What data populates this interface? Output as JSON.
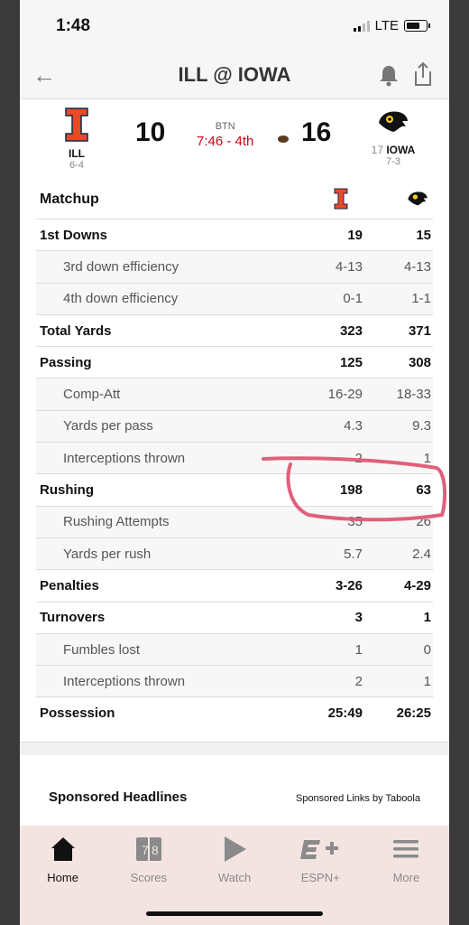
{
  "status_bar": {
    "time": "1:48",
    "network": "LTE"
  },
  "header": {
    "title": "ILL @ IOWA"
  },
  "scoreboard": {
    "away": {
      "abbr": "ILL",
      "record": "6-4",
      "score": "10"
    },
    "home": {
      "rank": "17",
      "abbr": "IOWA",
      "record": "7-3",
      "score": "16"
    },
    "network": "BTN",
    "clock": "7:46 - 4th"
  },
  "matchup_label": "Matchup",
  "stats": [
    {
      "label": "1st Downs",
      "ill": "19",
      "iowa": "15",
      "type": "main"
    },
    {
      "label": "3rd down efficiency",
      "ill": "4-13",
      "iowa": "4-13",
      "type": "sub"
    },
    {
      "label": "4th down efficiency",
      "ill": "0-1",
      "iowa": "1-1",
      "type": "sub"
    },
    {
      "label": "Total Yards",
      "ill": "323",
      "iowa": "371",
      "type": "main"
    },
    {
      "label": "Passing",
      "ill": "125",
      "iowa": "308",
      "type": "main"
    },
    {
      "label": "Comp-Att",
      "ill": "16-29",
      "iowa": "18-33",
      "type": "sub"
    },
    {
      "label": "Yards per pass",
      "ill": "4.3",
      "iowa": "9.3",
      "type": "sub"
    },
    {
      "label": "Interceptions thrown",
      "ill": "2",
      "iowa": "1",
      "type": "sub"
    },
    {
      "label": "Rushing",
      "ill": "198",
      "iowa": "63",
      "type": "main"
    },
    {
      "label": "Rushing Attempts",
      "ill": "35",
      "iowa": "26",
      "type": "sub"
    },
    {
      "label": "Yards per rush",
      "ill": "5.7",
      "iowa": "2.4",
      "type": "sub"
    },
    {
      "label": "Penalties",
      "ill": "3-26",
      "iowa": "4-29",
      "type": "main"
    },
    {
      "label": "Turnovers",
      "ill": "3",
      "iowa": "1",
      "type": "main"
    },
    {
      "label": "Fumbles lost",
      "ill": "1",
      "iowa": "0",
      "type": "sub"
    },
    {
      "label": "Interceptions thrown",
      "ill": "2",
      "iowa": "1",
      "type": "sub"
    },
    {
      "label": "Possession",
      "ill": "25:49",
      "iowa": "26:25",
      "type": "main"
    }
  ],
  "sponsored": {
    "heading": "Sponsored Headlines",
    "by": "Sponsored Links by Taboola"
  },
  "tabbar": [
    {
      "label": "Home",
      "icon": "home-icon"
    },
    {
      "label": "Scores",
      "icon": "scores-icon"
    },
    {
      "label": "Watch",
      "icon": "play-icon"
    },
    {
      "label": "ESPN+",
      "icon": "espn-plus-icon"
    },
    {
      "label": "More",
      "icon": "menu-icon"
    }
  ],
  "colors": {
    "illini_orange": "#e84a27",
    "live_red": "#d0021b",
    "annotation_pink": "#e0607a"
  }
}
